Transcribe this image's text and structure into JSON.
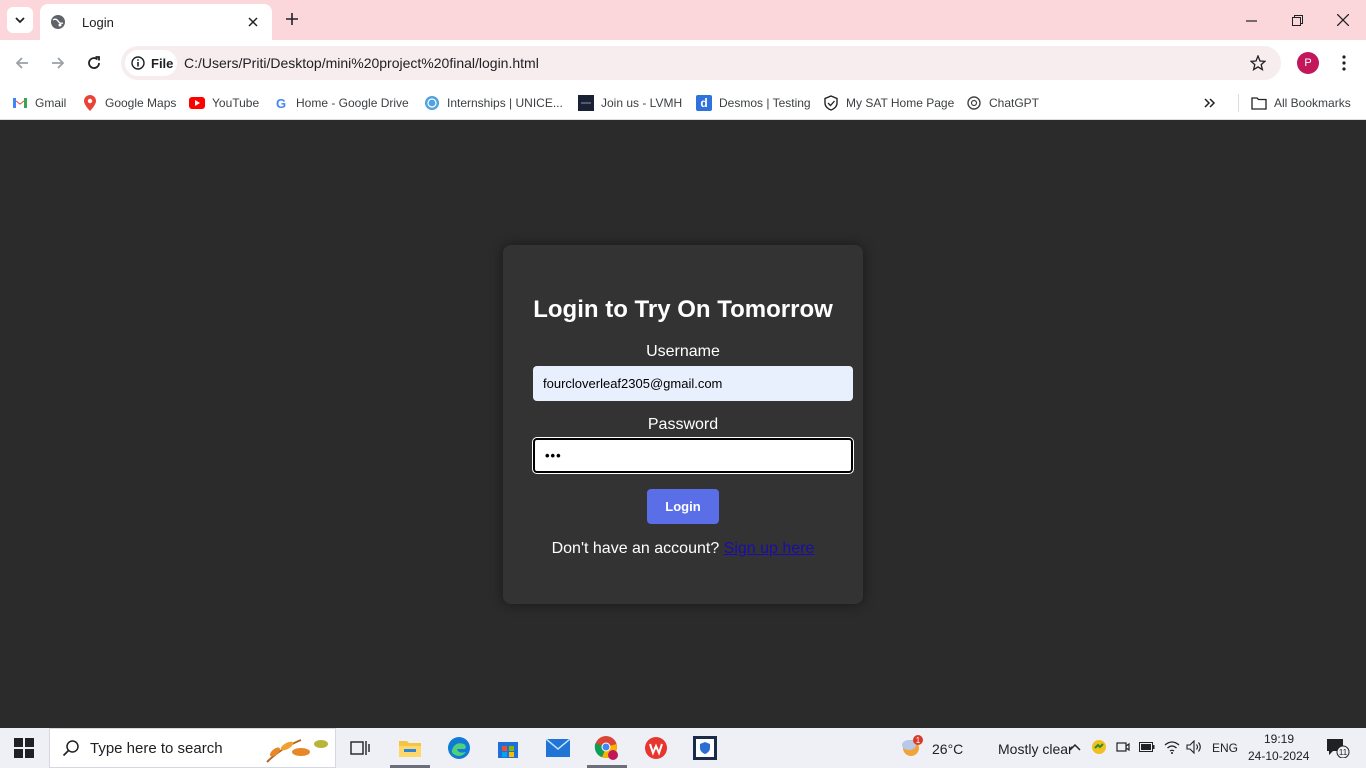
{
  "browser": {
    "tab_title": "Login",
    "site_chip_label": "File",
    "url": "C:/Users/Priti/Desktop/mini%20project%20final/login.html",
    "profile_initial": "P",
    "bookmarks": [
      {
        "label": "Gmail",
        "icon": "gmail-icon"
      },
      {
        "label": "Google Maps",
        "icon": "maps-icon"
      },
      {
        "label": "YouTube",
        "icon": "youtube-icon"
      },
      {
        "label": "Home - Google Drive",
        "icon": "google-icon"
      },
      {
        "label": "Internships | UNICE...",
        "icon": "unicef-icon"
      },
      {
        "label": "Join us - LVMH",
        "icon": "lvmh-icon"
      },
      {
        "label": "Desmos | Testing",
        "icon": "desmos-icon"
      },
      {
        "label": "My SAT Home Page",
        "icon": "sat-icon"
      },
      {
        "label": "ChatGPT",
        "icon": "chatgpt-icon"
      }
    ],
    "all_bookmarks_label": "All Bookmarks"
  },
  "login": {
    "heading": "Login to Try On Tomorrow",
    "username_label": "Username",
    "username_value": "fourcloverleaf2305@gmail.com",
    "password_label": "Password",
    "password_value": "•••",
    "button_label": "Login",
    "signup_prompt": "Don't have an account?",
    "signup_link": "Sign up here"
  },
  "taskbar": {
    "search_placeholder": "Type here to search",
    "weather_temp": "26°C",
    "weather_desc": "Mostly clear",
    "weather_badge": "1",
    "language": "ENG",
    "time": "19:19",
    "date": "24-10-2024",
    "notification_count": "11"
  },
  "colors": {
    "tabbar_bg": "#fbd7dc",
    "page_bg": "#2b2b2b",
    "card_bg": "#333333",
    "button_bg": "#5a6ee8",
    "link": "#1a0dab"
  }
}
